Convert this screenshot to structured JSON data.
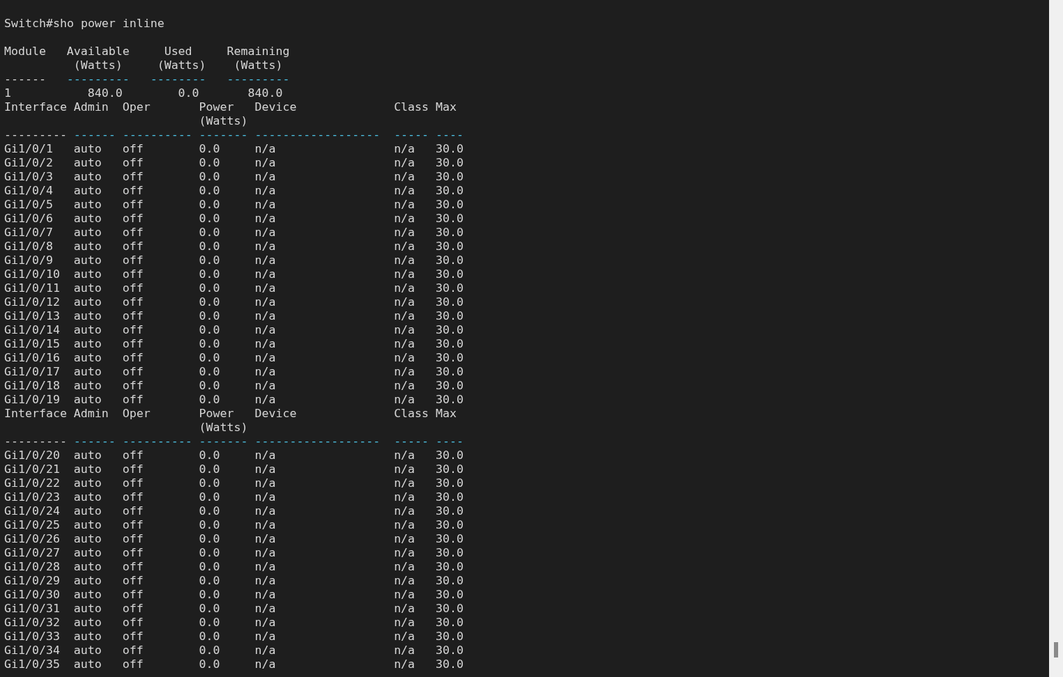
{
  "prompt": "Switch#sho power inline",
  "module_table": {
    "headers": [
      [
        "Module"
      ],
      [
        "Available",
        "(Watts)"
      ],
      [
        "Used",
        "(Watts)"
      ],
      [
        "Remaining",
        "(Watts)"
      ]
    ],
    "separators": [
      "------",
      "---------",
      "--------",
      "---------"
    ],
    "rows": [
      [
        "1",
        "840.0",
        "0.0",
        "840.0"
      ]
    ]
  },
  "interface_tables": [
    {
      "headers": [
        [
          "Interface"
        ],
        [
          "Admin"
        ],
        [
          "Oper"
        ],
        [
          "Power",
          "(Watts)"
        ],
        [
          "Device"
        ],
        [
          "Class"
        ],
        [
          "Max"
        ]
      ],
      "separators": [
        "---------",
        "------",
        "----------",
        "-------",
        "------------------",
        "-----",
        "----"
      ],
      "rows": [
        [
          "Gi1/0/1",
          "auto",
          "off",
          "0.0",
          "n/a",
          "n/a",
          "30.0"
        ],
        [
          "Gi1/0/2",
          "auto",
          "off",
          "0.0",
          "n/a",
          "n/a",
          "30.0"
        ],
        [
          "Gi1/0/3",
          "auto",
          "off",
          "0.0",
          "n/a",
          "n/a",
          "30.0"
        ],
        [
          "Gi1/0/4",
          "auto",
          "off",
          "0.0",
          "n/a",
          "n/a",
          "30.0"
        ],
        [
          "Gi1/0/5",
          "auto",
          "off",
          "0.0",
          "n/a",
          "n/a",
          "30.0"
        ],
        [
          "Gi1/0/6",
          "auto",
          "off",
          "0.0",
          "n/a",
          "n/a",
          "30.0"
        ],
        [
          "Gi1/0/7",
          "auto",
          "off",
          "0.0",
          "n/a",
          "n/a",
          "30.0"
        ],
        [
          "Gi1/0/8",
          "auto",
          "off",
          "0.0",
          "n/a",
          "n/a",
          "30.0"
        ],
        [
          "Gi1/0/9",
          "auto",
          "off",
          "0.0",
          "n/a",
          "n/a",
          "30.0"
        ],
        [
          "Gi1/0/10",
          "auto",
          "off",
          "0.0",
          "n/a",
          "n/a",
          "30.0"
        ],
        [
          "Gi1/0/11",
          "auto",
          "off",
          "0.0",
          "n/a",
          "n/a",
          "30.0"
        ],
        [
          "Gi1/0/12",
          "auto",
          "off",
          "0.0",
          "n/a",
          "n/a",
          "30.0"
        ],
        [
          "Gi1/0/13",
          "auto",
          "off",
          "0.0",
          "n/a",
          "n/a",
          "30.0"
        ],
        [
          "Gi1/0/14",
          "auto",
          "off",
          "0.0",
          "n/a",
          "n/a",
          "30.0"
        ],
        [
          "Gi1/0/15",
          "auto",
          "off",
          "0.0",
          "n/a",
          "n/a",
          "30.0"
        ],
        [
          "Gi1/0/16",
          "auto",
          "off",
          "0.0",
          "n/a",
          "n/a",
          "30.0"
        ],
        [
          "Gi1/0/17",
          "auto",
          "off",
          "0.0",
          "n/a",
          "n/a",
          "30.0"
        ],
        [
          "Gi1/0/18",
          "auto",
          "off",
          "0.0",
          "n/a",
          "n/a",
          "30.0"
        ],
        [
          "Gi1/0/19",
          "auto",
          "off",
          "0.0",
          "n/a",
          "n/a",
          "30.0"
        ]
      ]
    },
    {
      "headers": [
        [
          "Interface"
        ],
        [
          "Admin"
        ],
        [
          "Oper"
        ],
        [
          "Power",
          "(Watts)"
        ],
        [
          "Device"
        ],
        [
          "Class"
        ],
        [
          "Max"
        ]
      ],
      "separators": [
        "---------",
        "------",
        "----------",
        "-------",
        "------------------",
        "-----",
        "----"
      ],
      "rows": [
        [
          "Gi1/0/20",
          "auto",
          "off",
          "0.0",
          "n/a",
          "n/a",
          "30.0"
        ],
        [
          "Gi1/0/21",
          "auto",
          "off",
          "0.0",
          "n/a",
          "n/a",
          "30.0"
        ],
        [
          "Gi1/0/22",
          "auto",
          "off",
          "0.0",
          "n/a",
          "n/a",
          "30.0"
        ],
        [
          "Gi1/0/23",
          "auto",
          "off",
          "0.0",
          "n/a",
          "n/a",
          "30.0"
        ],
        [
          "Gi1/0/24",
          "auto",
          "off",
          "0.0",
          "n/a",
          "n/a",
          "30.0"
        ],
        [
          "Gi1/0/25",
          "auto",
          "off",
          "0.0",
          "n/a",
          "n/a",
          "30.0"
        ],
        [
          "Gi1/0/26",
          "auto",
          "off",
          "0.0",
          "n/a",
          "n/a",
          "30.0"
        ],
        [
          "Gi1/0/27",
          "auto",
          "off",
          "0.0",
          "n/a",
          "n/a",
          "30.0"
        ],
        [
          "Gi1/0/28",
          "auto",
          "off",
          "0.0",
          "n/a",
          "n/a",
          "30.0"
        ],
        [
          "Gi1/0/29",
          "auto",
          "off",
          "0.0",
          "n/a",
          "n/a",
          "30.0"
        ],
        [
          "Gi1/0/30",
          "auto",
          "off",
          "0.0",
          "n/a",
          "n/a",
          "30.0"
        ],
        [
          "Gi1/0/31",
          "auto",
          "off",
          "0.0",
          "n/a",
          "n/a",
          "30.0"
        ],
        [
          "Gi1/0/32",
          "auto",
          "off",
          "0.0",
          "n/a",
          "n/a",
          "30.0"
        ],
        [
          "Gi1/0/33",
          "auto",
          "off",
          "0.0",
          "n/a",
          "n/a",
          "30.0"
        ],
        [
          "Gi1/0/34",
          "auto",
          "off",
          "0.0",
          "n/a",
          "n/a",
          "30.0"
        ],
        [
          "Gi1/0/35",
          "auto",
          "off",
          "0.0",
          "n/a",
          "n/a",
          "30.0"
        ]
      ]
    }
  ]
}
